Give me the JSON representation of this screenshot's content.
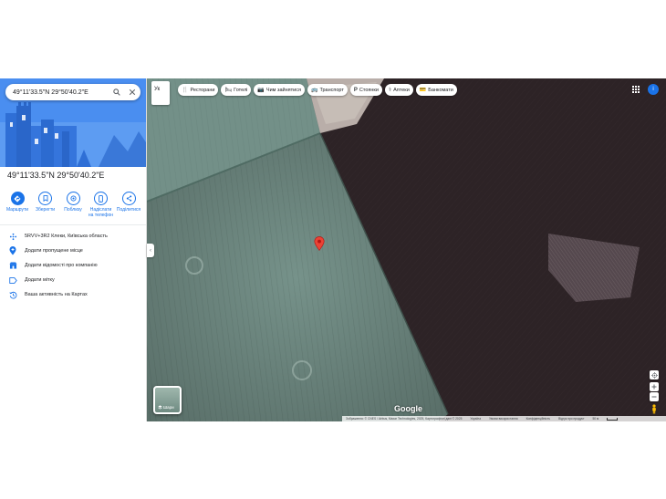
{
  "search": {
    "value": "49°11'33.5\"N 29°50'40.2\"E"
  },
  "place": {
    "title": "49°11'33.5\"N 29°50'40.2\"E"
  },
  "actions": [
    {
      "label": "Маршрути",
      "icon": "directions-icon"
    },
    {
      "label": "Зберегти",
      "icon": "bookmark-icon"
    },
    {
      "label": "Поблизу",
      "icon": "nearby-icon"
    },
    {
      "label": "Надіслати на телефон",
      "icon": "send-to-phone-icon"
    },
    {
      "label": "Поділитися",
      "icon": "share-icon"
    }
  ],
  "info": [
    {
      "text": "5RVV+3R2 Клеки, Київська область",
      "icon": "plus-code-icon"
    },
    {
      "text": "Додати пропущене місце",
      "icon": "add-place-icon"
    },
    {
      "text": "Додати відомості про компанію",
      "icon": "business-icon"
    },
    {
      "text": "Додати мітку",
      "icon": "label-icon"
    },
    {
      "text": "Ваша активність на Картах",
      "icon": "history-icon"
    }
  ],
  "map": {
    "language": "Ук",
    "chips": [
      {
        "label": "Ресторани",
        "icon": "restaurant-icon",
        "glyph": "🍴"
      },
      {
        "label": "Готелі",
        "icon": "hotel-icon",
        "glyph": "🛏"
      },
      {
        "label": "Чим зайнятися",
        "icon": "things-to-do-icon",
        "glyph": "📷"
      },
      {
        "label": "Транспорт",
        "icon": "transit-icon",
        "glyph": "🚌"
      },
      {
        "label": "Стоянки",
        "icon": "parking-icon",
        "glyph": "P"
      },
      {
        "label": "Аптеки",
        "icon": "pharmacy-icon",
        "glyph": "⚕"
      },
      {
        "label": "Банкомати",
        "icon": "atm-icon",
        "glyph": "💳"
      }
    ],
    "layers_label": "Шари",
    "logo": "Google",
    "avatar_letter": "і",
    "footer": [
      "Зображення: © CNES / Airbus, Maxar Technologies, 2025, Картографічні дані © 2025",
      "Україна",
      "Умови використання",
      "Конфіденційність",
      "Відгук про продукт",
      "50 м"
    ],
    "pin_color": "#ea4335",
    "accent": "#1a73e8"
  }
}
